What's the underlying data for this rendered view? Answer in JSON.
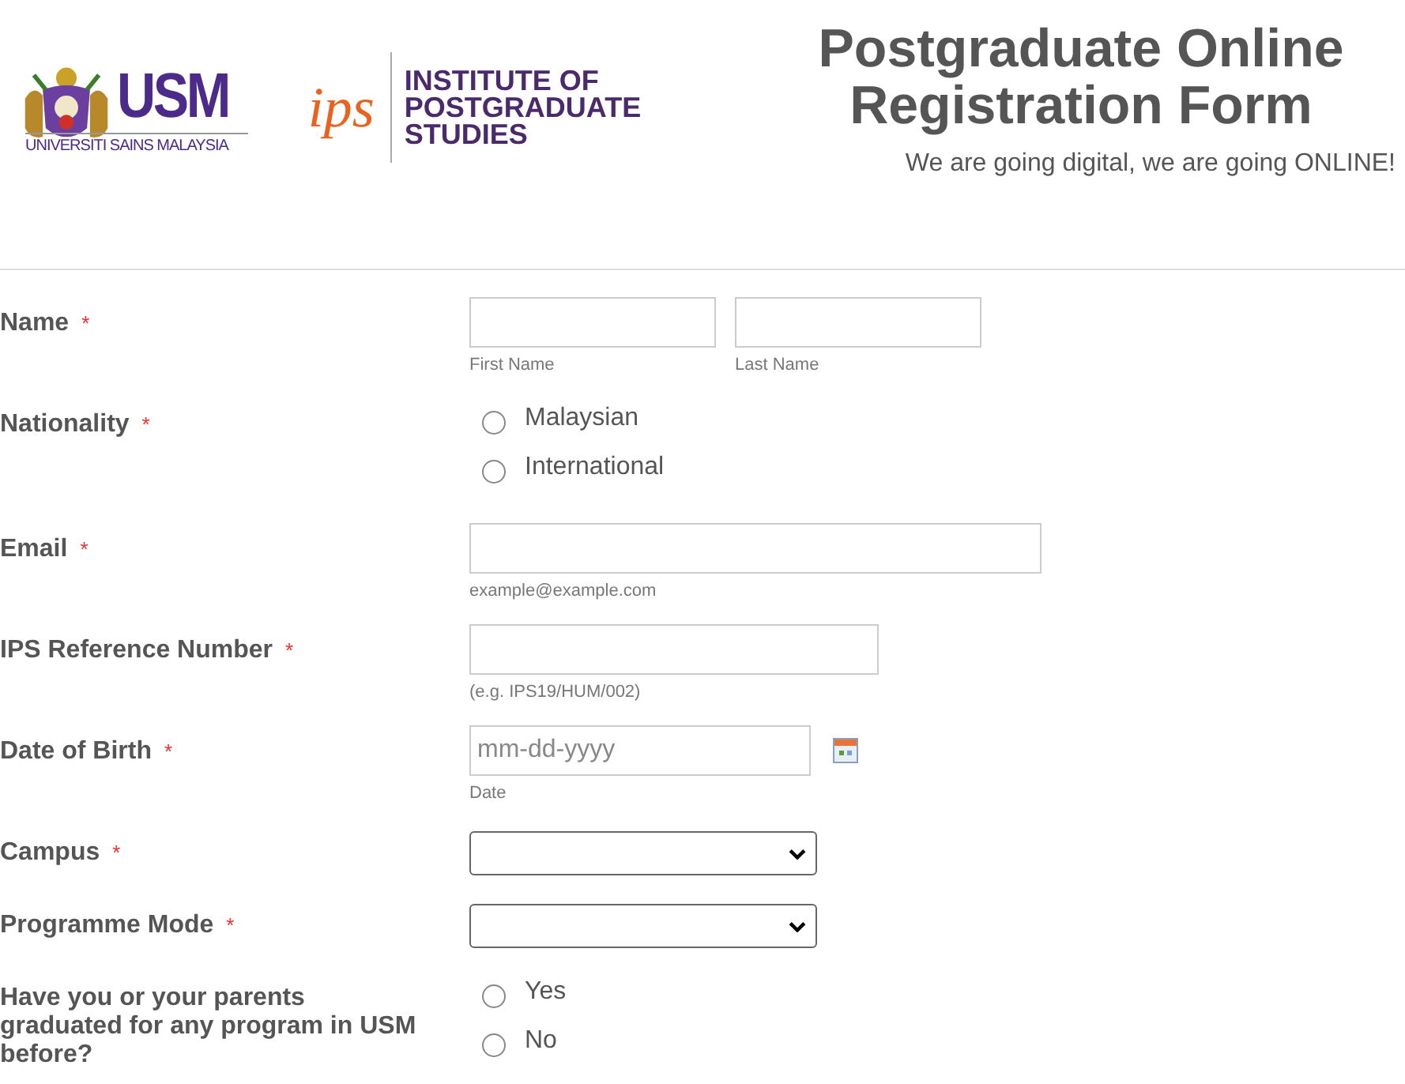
{
  "header": {
    "usm_logo": {
      "mark": "USM",
      "caption": "UNIVERSITI SAINS MALAYSIA"
    },
    "ips_logo": {
      "mark": "ips",
      "lines": [
        "INSTITUTE OF",
        "POSTGRADUATE",
        "STUDIES"
      ]
    },
    "title": "Postgraduate Online Registration Form",
    "subtitle": "We are going digital, we are going ONLINE!"
  },
  "fields": [
    {
      "label": "Name",
      "required_mark": "*",
      "kind": "name",
      "inputs": [
        {
          "sublabel": "First Name"
        },
        {
          "sublabel": "Last Name"
        }
      ]
    },
    {
      "label": "Nationality",
      "required_mark": "*",
      "kind": "radio",
      "options": [
        {
          "label": "Malaysian",
          "selected": false
        },
        {
          "label": "International",
          "selected": false
        }
      ]
    },
    {
      "label": "Email",
      "required_mark": "*",
      "kind": "text",
      "sublabel": "example@example.com"
    },
    {
      "label": "IPS Reference Number",
      "required_mark": "*",
      "kind": "text",
      "sublabel": "(e.g. IPS19/HUM/002)"
    },
    {
      "label": "Date of Birth",
      "required_mark": "*",
      "kind": "date",
      "placeholder": "mm-dd-yyyy",
      "sublabel": "Date"
    },
    {
      "label": "Campus",
      "required_mark": "*",
      "kind": "select"
    },
    {
      "label": "Programme Mode",
      "required_mark": "*",
      "kind": "select"
    },
    {
      "label": "Have you or your parents graduated for any program in USM before?",
      "kind": "radio",
      "options": [
        {
          "label": "Yes",
          "selected": false
        },
        {
          "label": "No",
          "selected": false
        }
      ]
    }
  ]
}
